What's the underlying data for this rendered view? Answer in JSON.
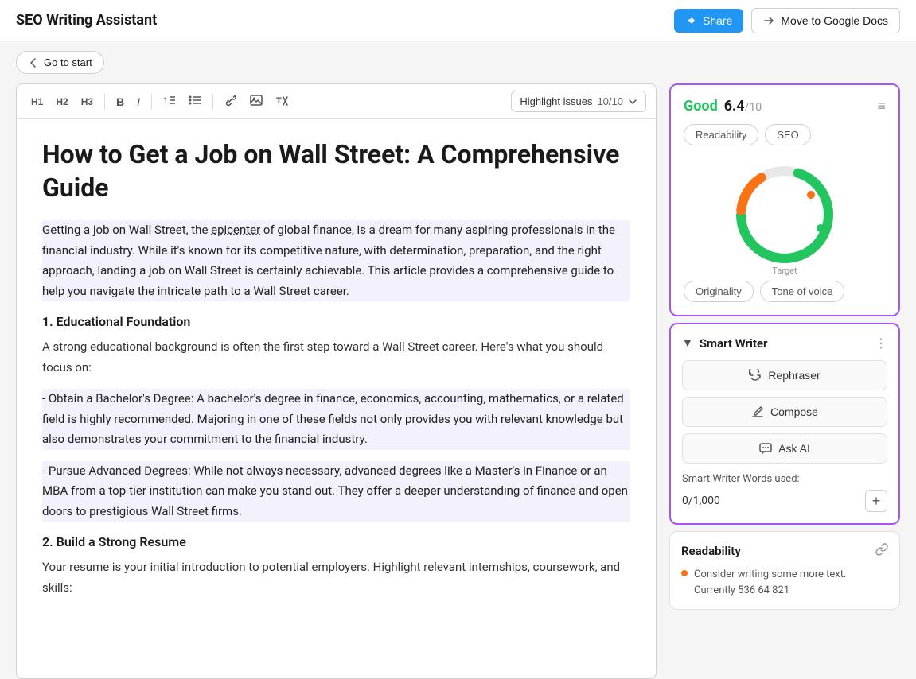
{
  "header": {
    "title": "SEO Writing Assistant",
    "share_label": "Share",
    "google_docs_label": "Move to Google Docs"
  },
  "sub_header": {
    "go_to_start_label": "Go to start"
  },
  "editor": {
    "toolbar": {
      "h1": "H1",
      "h2": "H2",
      "h3": "H3",
      "bold": "B",
      "italic": "I",
      "highlight_label": "Highlight issues",
      "highlight_count": "10/10"
    },
    "content": {
      "title": "How to Get a Job on Wall Street: A Comprehensive Guide",
      "paragraph1": "Getting a job on Wall Street, the epicenter of global finance, is a dream for many aspiring professionals in the financial industry. While it's known for its competitive nature, with determination, preparation, and the right approach, landing a job on Wall Street is certainly achievable. This article provides a comprehensive guide to help you navigate the intricate path to a Wall Street career.",
      "section1_heading": "1. Educational Foundation",
      "section1_para": "A strong educational background is often the first step toward a Wall Street career. Here's what you should focus on:",
      "bullet1": "- Obtain a Bachelor's Degree: A bachelor's degree in finance, economics, accounting, mathematics, or a related field is highly recommended. Majoring in one of these fields not only provides you with relevant knowledge but also demonstrates your commitment to the financial industry.",
      "bullet2": "- Pursue Advanced Degrees: While not always necessary, advanced degrees like a Master's in Finance or an MBA from a top-tier institution can make you stand out. They offer a deeper understanding of finance and open doors to prestigious Wall Street firms.",
      "section2_heading": "2. Build a Strong Resume",
      "section2_para": "Your resume is your initial introduction to potential employers. Highlight relevant internships, coursework, and skills:"
    }
  },
  "score_card": {
    "good_label": "Good",
    "score": "6.4",
    "max": "/10",
    "tabs": [
      "Readability",
      "SEO"
    ],
    "bottom_tabs": [
      "Originality",
      "Tone of voice"
    ],
    "target_label": "Target",
    "chart": {
      "green_percent": 70,
      "orange_percent": 15
    }
  },
  "smart_writer": {
    "title": "Smart Writer",
    "rephrase_label": "Rephraser",
    "compose_label": "Compose",
    "ask_ai_label": "Ask AI",
    "words_used_label": "Smart Writer Words used:",
    "words_used": "0",
    "words_total": "1,000"
  },
  "readability": {
    "title": "Readability",
    "tip": "Consider writing some more text. Currently 536 64 821"
  }
}
